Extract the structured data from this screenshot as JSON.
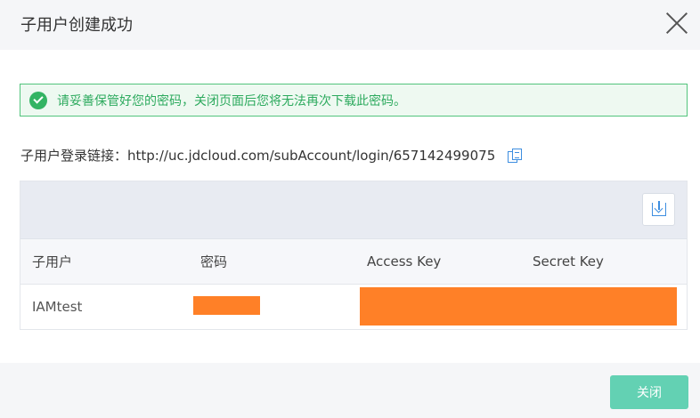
{
  "dialog": {
    "title": "子用户创建成功",
    "close_icon": "close-icon"
  },
  "alert": {
    "icon": "check-circle-icon",
    "text": "请妥善保管好您的密码，关闭页面后您将无法再次下载此密码。",
    "color": "#33b463"
  },
  "login": {
    "label": "子用户登录链接：",
    "url": "http://uc.jdcloud.com/subAccount/login/657142499075",
    "copy_icon": "copy-icon"
  },
  "table": {
    "download_icon": "download-icon",
    "columns": [
      "子用户",
      "密码",
      "Access Key",
      "Secret Key"
    ],
    "rows": [
      {
        "username": "IAMtest",
        "password": "",
        "access_key": "",
        "secret_key": ""
      }
    ],
    "redaction_color": "#ff8027"
  },
  "footer": {
    "close_label": "关闭",
    "button_color": "#63d1b3"
  }
}
